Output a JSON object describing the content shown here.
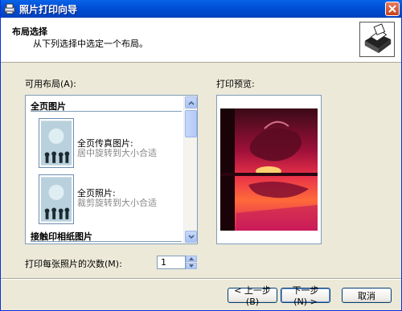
{
  "window": {
    "title": "照片打印向导"
  },
  "header": {
    "title": "布局选择",
    "subtitle": "从下列选择中选定一个布局。"
  },
  "layouts": {
    "label": "可用布局(A):",
    "groups": [
      {
        "title": "全页图片"
      },
      {
        "title": "接触印相纸图片"
      }
    ],
    "items": [
      {
        "title": "全页传真图片:",
        "desc": "居中旋转到大小合适"
      },
      {
        "title": "全页照片:",
        "desc": "裁剪旋转到大小合适"
      }
    ]
  },
  "preview": {
    "label": "打印预览:"
  },
  "copies": {
    "label": "打印每张照片的次数(M):",
    "value": "1"
  },
  "buttons": {
    "back": "< 上一步(B)",
    "next": "下一步(N) >",
    "cancel": "取消"
  },
  "colors": {
    "titlebar": "#0054e3",
    "face": "#ece9d8",
    "border": "#7f9db9"
  },
  "icons": [
    "printer-wizard-icon",
    "printer-icon",
    "close-icon",
    "scroll-up-icon",
    "scroll-down-icon",
    "spin-up-icon",
    "spin-down-icon"
  ]
}
